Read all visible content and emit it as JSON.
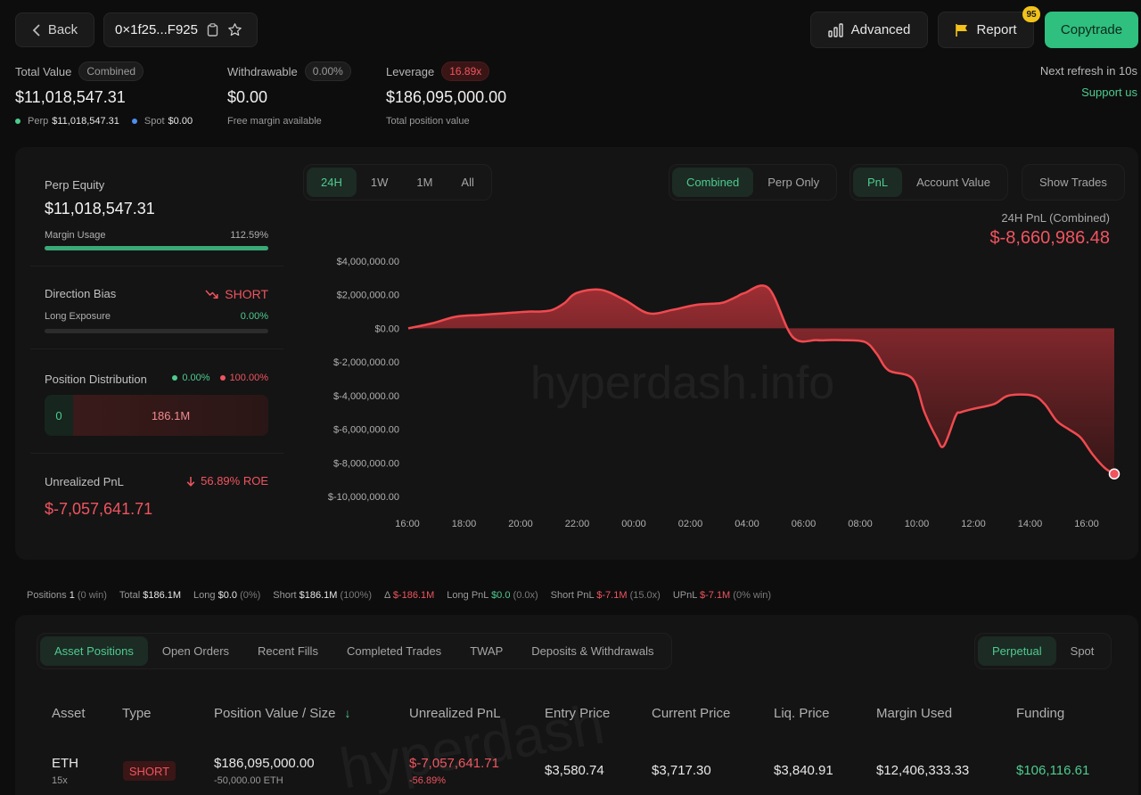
{
  "header": {
    "back_label": "Back",
    "address": "0×1f25...F925",
    "advanced_label": "Advanced",
    "report_label": "Report",
    "report_badge": "95",
    "copytrade_label": "Copytrade",
    "next_refresh": "Next refresh in 10s",
    "support": "Support us"
  },
  "stats": {
    "total_value": {
      "label": "Total Value",
      "pill": "Combined",
      "value": "$11,018,547.31",
      "perp_label": "Perp",
      "perp_value": "$11,018,547.31",
      "spot_label": "Spot",
      "spot_value": "$0.00"
    },
    "withdrawable": {
      "label": "Withdrawable",
      "pill": "0.00%",
      "value": "$0.00",
      "sub": "Free margin available"
    },
    "leverage": {
      "label": "Leverage",
      "pill": "16.89x",
      "value": "$186,095,000.00",
      "sub": "Total position value"
    }
  },
  "sidebar": {
    "perp_equity_label": "Perp Equity",
    "perp_equity_value": "$11,018,547.31",
    "margin_usage_label": "Margin Usage",
    "margin_usage_value": "112.59%",
    "margin_usage_fraction": 1.0,
    "direction_bias_label": "Direction Bias",
    "direction_bias_value": "SHORT",
    "long_exposure_label": "Long Exposure",
    "long_exposure_value": "0.00%",
    "long_exposure_fraction": 0.0,
    "position_distribution_label": "Position Distribution",
    "dist_long_pct": "0.00%",
    "dist_short_pct": "100.00%",
    "dist_long_value": "0",
    "dist_short_value": "186.1M",
    "unrealized_pnl_label": "Unrealized PnL",
    "roe": "56.89% ROE",
    "unrealized_pnl_value": "$-7,057,641.71"
  },
  "chart_controls": {
    "ranges": [
      "24H",
      "1W",
      "1M",
      "All"
    ],
    "active_range": 0,
    "modes": [
      "Combined",
      "Perp Only"
    ],
    "active_mode": 0,
    "metrics": [
      "PnL",
      "Account Value"
    ],
    "active_metric": 0,
    "show_trades": "Show Trades"
  },
  "chart_header": {
    "label": "24H PnL (Combined)",
    "value": "$-8,660,986.48"
  },
  "watermark": "hyperdash.info",
  "watermark2": "hyperdash",
  "chart_data": {
    "type": "area",
    "x_ticks": [
      "16:00",
      "18:00",
      "20:00",
      "22:00",
      "00:00",
      "02:00",
      "04:00",
      "06:00",
      "08:00",
      "10:00",
      "12:00",
      "14:00",
      "16:00"
    ],
    "y_ticks": [
      "$4,000,000.00",
      "$2,000,000.00",
      "$0.00",
      "$-2,000,000.00",
      "$-4,000,000.00",
      "$-6,000,000.00",
      "$-8,000,000.00",
      "$-10,000,000.00"
    ],
    "ylim": [
      -10000000,
      4000000
    ],
    "x_hours": [
      0,
      1,
      2,
      3,
      4,
      5,
      5.5,
      6,
      6.5,
      7,
      8,
      9,
      10,
      11,
      12,
      13,
      13.4,
      13.7,
      14,
      15,
      16,
      17,
      17.5,
      18,
      19,
      19.5,
      20,
      21,
      21.5,
      22,
      22.3,
      22.8,
      23,
      23.5,
      24.4,
      25,
      26,
      26.5,
      27,
      27.5,
      28,
      28.5,
      29,
      29.4
    ],
    "values": [
      0,
      300000,
      700000,
      800000,
      900000,
      1000000,
      1000000,
      1100000,
      1500000,
      2100000,
      2300000,
      1700000,
      900000,
      1100000,
      1400000,
      1500000,
      1700000,
      1900000,
      2100000,
      2400000,
      -500000,
      -700000,
      -700000,
      -700000,
      -800000,
      -1500000,
      -2500000,
      -3000000,
      -5000000,
      -6500000,
      -7000000,
      -5200000,
      -5000000,
      -4800000,
      -4500000,
      -4000000,
      -4000000,
      -4500000,
      -5500000,
      -6000000,
      -6500000,
      -7500000,
      -8300000,
      -8660986
    ]
  },
  "summary": {
    "positions_label": "Positions",
    "positions_value": "1",
    "positions_note": "(0 win)",
    "total_label": "Total",
    "total_value": "$186.1M",
    "long_label": "Long",
    "long_value": "$0.0",
    "long_note": "(0%)",
    "short_label": "Short",
    "short_value": "$186.1M",
    "short_note": "(100%)",
    "delta_label": "Δ",
    "delta_value": "$-186.1M",
    "long_pnl_label": "Long PnL",
    "long_pnl_value": "$0.0",
    "long_pnl_note": "(0.0x)",
    "short_pnl_label": "Short PnL",
    "short_pnl_value": "$-7.1M",
    "short_pnl_note": "(15.0x)",
    "upnl_label": "UPnL",
    "upnl_value": "$-7.1M",
    "upnl_note": "(0% win)"
  },
  "tabs": {
    "items": [
      "Asset Positions",
      "Open Orders",
      "Recent Fills",
      "Completed Trades",
      "TWAP",
      "Deposits & Withdrawals"
    ],
    "active": 0,
    "market_items": [
      "Perpetual",
      "Spot"
    ],
    "market_active": 0
  },
  "table": {
    "headers": [
      "Asset",
      "Type",
      "Position Value / Size",
      "Unrealized PnL",
      "Entry Price",
      "Current Price",
      "Liq. Price",
      "Margin Used",
      "Funding"
    ],
    "sort_indicator": "↓",
    "row": {
      "asset": "ETH",
      "leverage": "15x",
      "type": "SHORT",
      "position_value": "$186,095,000.00",
      "size": "-50,000.00 ETH",
      "unrealized_pnl": "$-7,057,641.71",
      "unrealized_pct": "-56.89%",
      "entry_price": "$3,580.74",
      "current_price": "$3,717.30",
      "liq_price": "$3,840.91",
      "margin_used": "$12,406,333.33",
      "funding": "$106,116.61"
    }
  },
  "colors": {
    "accent_green": "#4ecb8f",
    "loss_red": "#f0545f",
    "copytrade_bg": "#2fbf7f"
  }
}
